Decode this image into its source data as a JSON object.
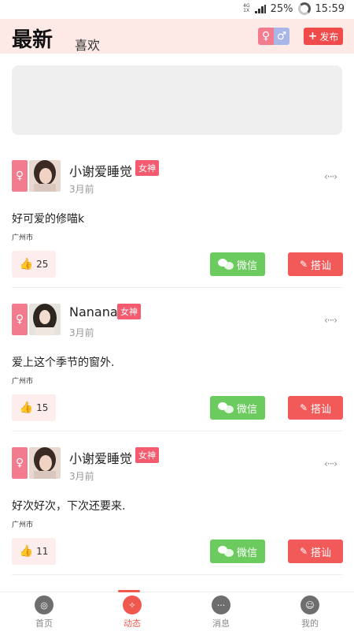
{
  "status_bar": {
    "net_top": "4G",
    "net_bottom": "1X",
    "battery": "25%",
    "time": "15:59"
  },
  "header": {
    "tab_latest": "最新",
    "tab_like": "喜欢",
    "gender_female": "♀",
    "gender_male": "♂",
    "publish": "发布",
    "colors": {
      "background": "#fde9e6",
      "accent": "#f04a4a"
    }
  },
  "posts": [
    {
      "gender": "♀",
      "username": "小谢爱睡觉",
      "tag": "女神",
      "time": "3月前",
      "content": "好可爱的修喵k",
      "location": "广州市",
      "likes": "25",
      "liked": true,
      "wechat": "微信",
      "chat": "搭讪",
      "more": "‹···›"
    },
    {
      "gender": "♀",
      "username": "Nanana",
      "tag": "女神",
      "time": "3月前",
      "content": "爱上这个季节的窗外.",
      "location": "广州市",
      "likes": "15",
      "liked": false,
      "wechat": "微信",
      "chat": "搭讪",
      "more": "‹···›"
    },
    {
      "gender": "♀",
      "username": "小谢爱睡觉",
      "tag": "女神",
      "time": "3月前",
      "content": "好次好次，下次还要来.",
      "location": "广州市",
      "likes": "11",
      "liked": false,
      "wechat": "微信",
      "chat": "搭讪",
      "more": "‹···›"
    }
  ],
  "tabbar": {
    "items": [
      {
        "label": "首页",
        "icon": "home-icon"
      },
      {
        "label": "动态",
        "icon": "moments-icon"
      },
      {
        "label": "消息",
        "icon": "message-icon"
      },
      {
        "label": "我的",
        "icon": "profile-icon"
      }
    ],
    "active_color": "#f0584e"
  }
}
